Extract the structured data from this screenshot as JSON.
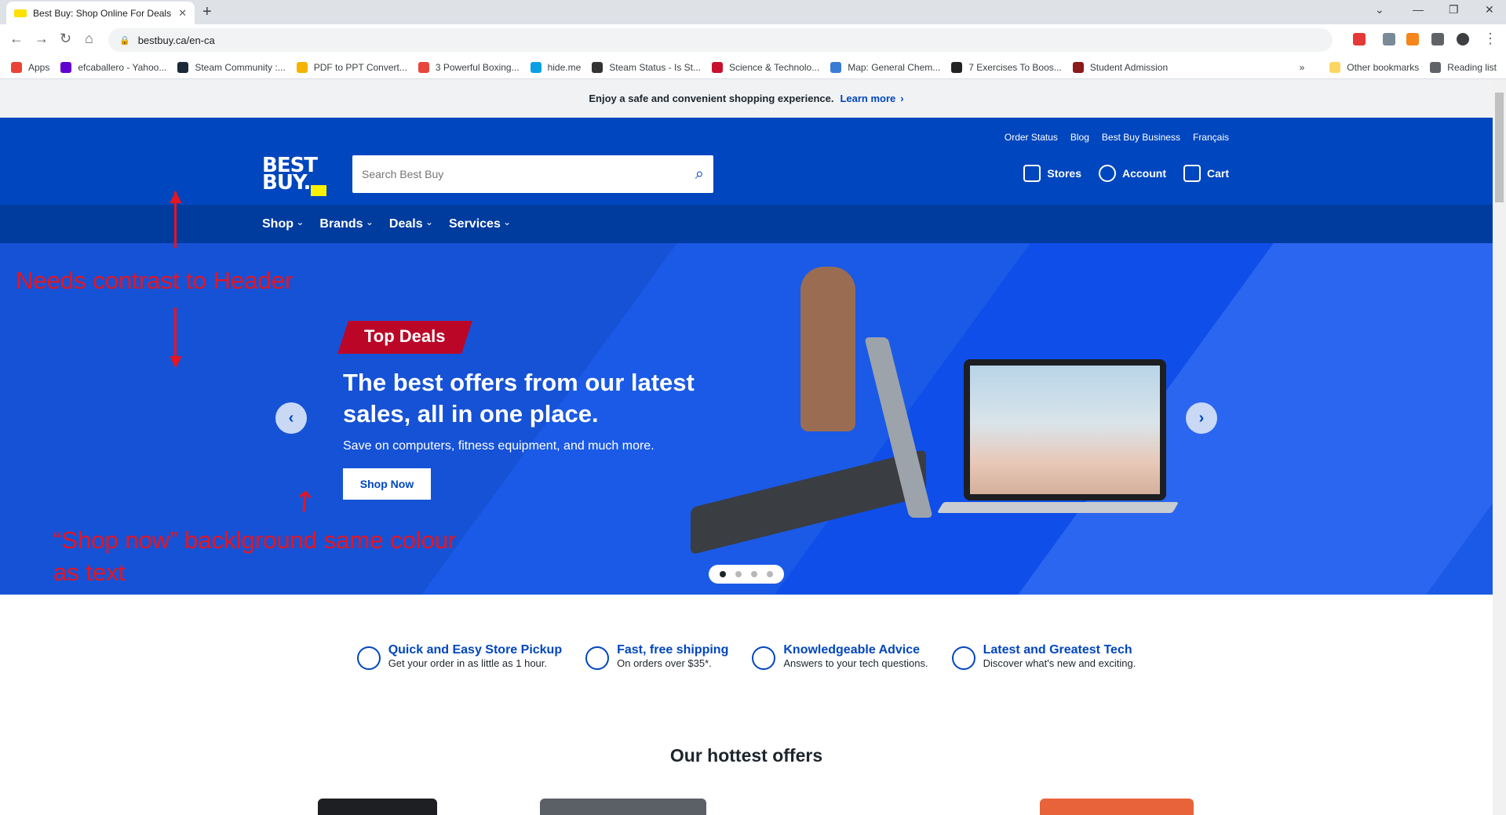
{
  "browser": {
    "tab_title": "Best Buy: Shop Online For Deals",
    "url": "bestbuy.ca/en-ca",
    "bookmarks": [
      {
        "label": "Apps",
        "color": "#ea4335"
      },
      {
        "label": "efcaballero - Yahoo...",
        "color": "#6001d2"
      },
      {
        "label": "Steam Community :...",
        "color": "#1b2838"
      },
      {
        "label": "PDF to PPT Convert...",
        "color": "#f4b400"
      },
      {
        "label": "3 Powerful Boxing...",
        "color": "#e8453c"
      },
      {
        "label": "hide.me",
        "color": "#0aa0e6"
      },
      {
        "label": "Steam Status - Is St...",
        "color": "#333333"
      },
      {
        "label": "Science & Technolo...",
        "color": "#c8102e"
      },
      {
        "label": "Map: General Chem...",
        "color": "#3a7bd5"
      },
      {
        "label": "7 Exercises To Boos...",
        "color": "#222222"
      },
      {
        "label": "Student Admission",
        "color": "#8b1a1a"
      }
    ],
    "other_bookmarks": "Other bookmarks",
    "reading_list": "Reading list"
  },
  "promo_strip": {
    "text": "Enjoy a safe and convenient shopping experience.",
    "link": "Learn more"
  },
  "header": {
    "logo_line1": "BEST",
    "logo_line2": "BUY.",
    "search_placeholder": "Search Best Buy",
    "top_links": [
      "Order Status",
      "Blog",
      "Best Buy Business",
      "Français"
    ],
    "utility": [
      "Stores",
      "Account",
      "Cart"
    ],
    "nav": [
      "Shop",
      "Brands",
      "Deals",
      "Services"
    ]
  },
  "hero": {
    "badge": "Top Deals",
    "headline": "The best offers from our latest sales, all in one place.",
    "subtext": "Save on computers, fitness equipment, and much more.",
    "cta": "Shop Now",
    "slides": 4,
    "active_slide": 1
  },
  "annotations": {
    "header_contrast": "Needs contrast to Header",
    "shop_now_line1": "“Shop now” backlground same colour",
    "shop_now_line2": "as text"
  },
  "features": [
    {
      "title": "Quick and Easy Store Pickup",
      "desc": "Get your order in as little as 1 hour."
    },
    {
      "title": "Fast, free shipping",
      "desc": "On orders over $35*."
    },
    {
      "title": "Knowledgeable Advice",
      "desc": "Answers to your tech questions."
    },
    {
      "title": "Latest and Greatest Tech",
      "desc": "Discover what's new and exciting."
    }
  ],
  "section_title": "Our hottest offers",
  "colors": {
    "brand_blue": "#0046be",
    "brand_yellow": "#fff200",
    "deal_red": "#bb0628",
    "annotation_red": "#e8141e"
  }
}
